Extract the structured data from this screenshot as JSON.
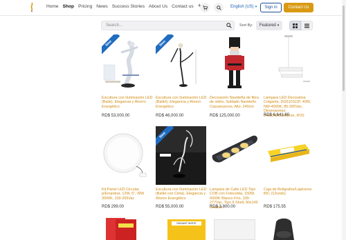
{
  "nav": {
    "items": [
      "Home",
      "Shop",
      "Pricing",
      "News",
      "Success Stories",
      "About Us",
      "Contact us"
    ],
    "active": "Shop",
    "plus": "+"
  },
  "header": {
    "language": "English (US)",
    "signin_label": "Sign in",
    "contact_label": "Contact Us"
  },
  "toolbar": {
    "search_placeholder": "Search...",
    "sort_label": "Sort By:",
    "sort_value": "Featured"
  },
  "ribbon_label": "New",
  "products": [
    {
      "title": "Escultura con Iluminación LED (Baile), Elegancia y Ahorro Energético",
      "price": "RD$ 53,000.00",
      "ribbon": true
    },
    {
      "title": "Escultura con Iluminación LED (Ballet), Elegancia y Ahorro Energético",
      "price": "RD$ 46,000.00",
      "ribbon": true
    },
    {
      "title": "Decoración Navideña de fibra de vidrio. Soldado Navideño Cascanueces, Alto: 240cm",
      "price": "RD$ 125,000.00",
      "ribbon": false
    },
    {
      "title": "Lámpara LED Decorativa Colgante, DG510111P, 40W, NW-4000K, 85-265Vac, Dimensiones: 340x340x1200mm, IP20",
      "price": "RD$ 6,641.60",
      "ribbon": false
    },
    {
      "title": "Kit Panel LED Circular, p/Empotrar, 12W, 6\", WW 3000K, 100-265Vac",
      "price": "RD$ 299.00",
      "ribbon": false
    },
    {
      "title": "Escultura con Iluminación LED (Ballet con Cinta), Elegancia y Ahorro Energético",
      "price": "RD$ 55,000.00",
      "ribbon": true
    },
    {
      "title": "Lampara de Calle LED Tipo COB con Fotocelda, 150W, 6000K Blanco Frío, 100-277Vac, Tipo II Shell, 90x145 Grados",
      "price": "RD$ 3,800.00",
      "ribbon": false
    },
    {
      "title": "Caja de Bolígrafos/Lapiceros BIC (12unds)",
      "price": "RD$ 175.55",
      "ribbon": false
    }
  ],
  "partial_labels": {
    "paint_can": "RADIANT WHITE"
  },
  "colors": {
    "accent": "#d99a13",
    "link": "#1a4f99",
    "ribbon": "#1f6cc0",
    "title": "#d08a10"
  },
  "icons": [
    "cart-icon",
    "search-icon",
    "grid-view-icon",
    "list-view-icon"
  ]
}
